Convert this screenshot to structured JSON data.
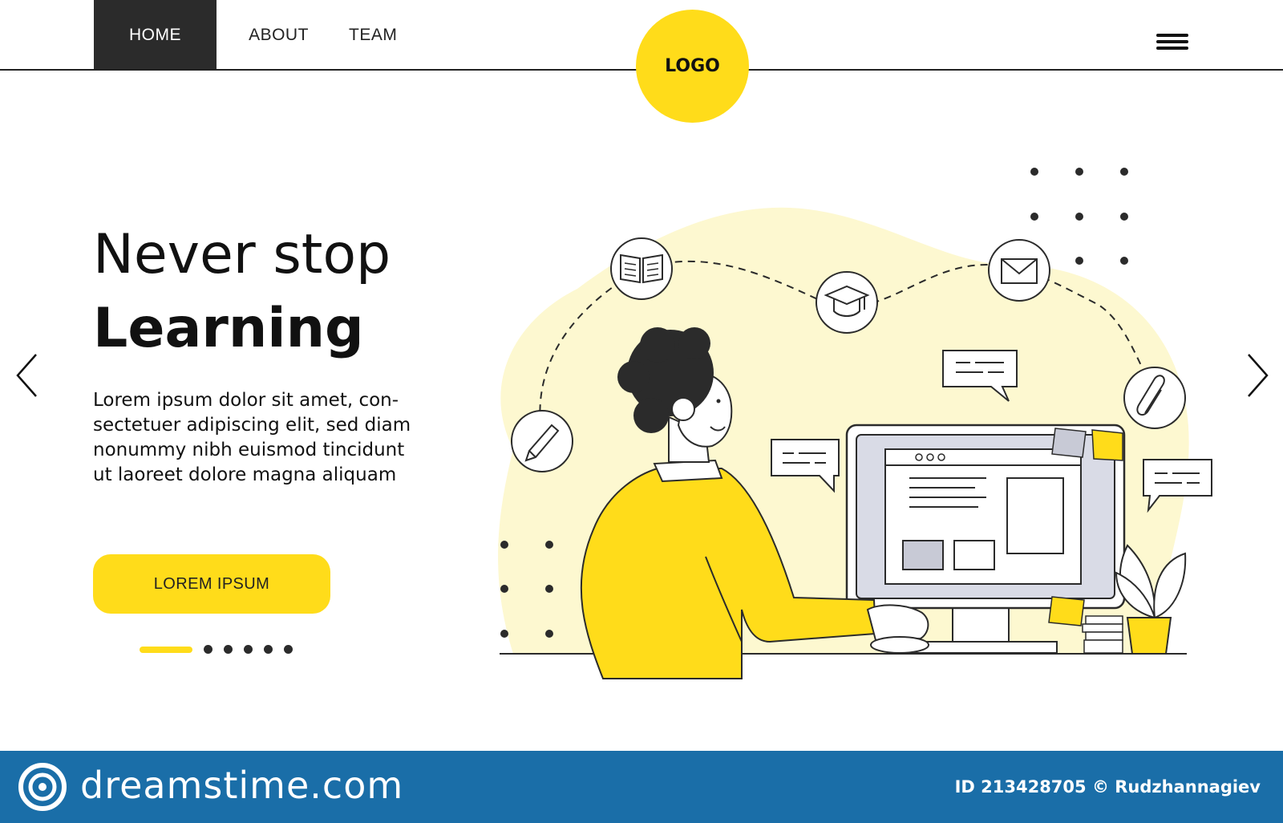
{
  "header": {
    "nav": [
      {
        "label": "HOME"
      },
      {
        "label": "ABOUT"
      },
      {
        "label": "TEAM"
      }
    ],
    "logo_text": "LOGO",
    "menu_icon": "hamburger-menu-icon"
  },
  "hero": {
    "title_line1": "Never stop",
    "title_line2": "Learning",
    "body_lines": [
      "Lorem ipsum dolor sit amet, con-",
      "sectetuer adipiscing elit, sed diam",
      "nonummy nibh euismod tincidunt",
      "ut laoreet dolore magna aliquam"
    ],
    "cta_label": "LOREM IPSUM"
  },
  "slider": {
    "active_index": 0,
    "total": 6,
    "prev_icon": "chevron-left-icon",
    "next_icon": "chevron-right-icon"
  },
  "illustration": {
    "icons": [
      "open-book-icon",
      "graduation-cap-icon",
      "envelope-icon",
      "paperclip-icon",
      "pencil-icon"
    ]
  },
  "footer": {
    "brand": "dreamstime.com",
    "id_text": "ID 213428705 © Rudzhannagiev"
  },
  "colors": {
    "accent": "#ffdc1a",
    "accent_light": "#fdf8d0",
    "dark": "#2b2b2b",
    "footer_bg": "#1a6ea8"
  }
}
